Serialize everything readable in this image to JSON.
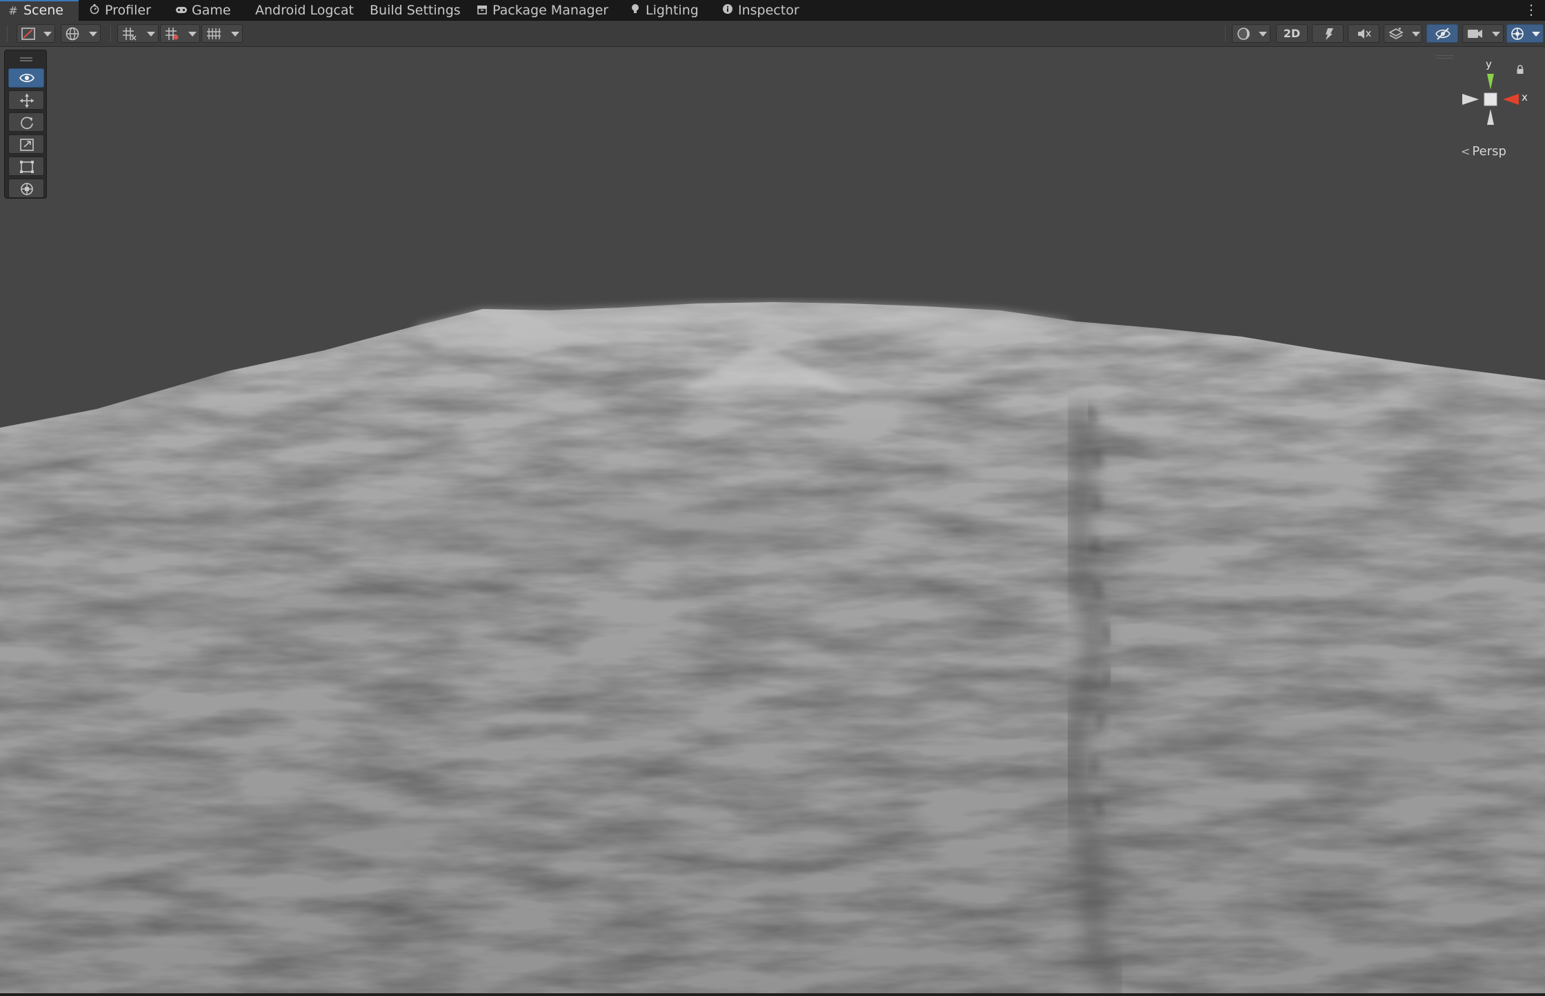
{
  "tabs": [
    {
      "label": "Scene",
      "icon": "grid-hash-icon",
      "active": true
    },
    {
      "label": "Profiler",
      "icon": "stopwatch-icon"
    },
    {
      "label": "Game",
      "icon": "gamepad-icon"
    },
    {
      "label": "Android Logcat",
      "icon": ""
    },
    {
      "label": "Build Settings",
      "icon": ""
    },
    {
      "label": "Package Manager",
      "icon": "package-icon"
    },
    {
      "label": "Lighting",
      "icon": "lightbulb-icon"
    },
    {
      "label": "Inspector",
      "icon": "info-icon"
    }
  ],
  "toolbar": {
    "left_buttons": [
      "draw-mode-icon",
      "global-space-icon",
      "grid-snapping-icon",
      "increment-snap-icon",
      "grid-visibility-icon"
    ],
    "right_buttons": [
      "shading-sphere-icon",
      "2d-toggle",
      "lighting-toggle-icon",
      "audio-toggle-icon",
      "effects-layers-icon",
      "hidden-objects-icon",
      "camera-icon",
      "gizmos-icon"
    ],
    "label_2d": "2D"
  },
  "tools": [
    "view-tool-icon",
    "move-tool-icon",
    "rotate-tool-icon",
    "scale-tool-icon",
    "rect-tool-icon",
    "transform-tool-icon"
  ],
  "gizmo": {
    "y_label": "y",
    "x_label": "x",
    "projection": "Persp",
    "colors": {
      "y": "#8bd14a",
      "x": "#e0432d",
      "neutral": "#d8d8d8"
    }
  },
  "viewport": {
    "background": "#464646",
    "terrain_color": "#9b9b9b"
  }
}
